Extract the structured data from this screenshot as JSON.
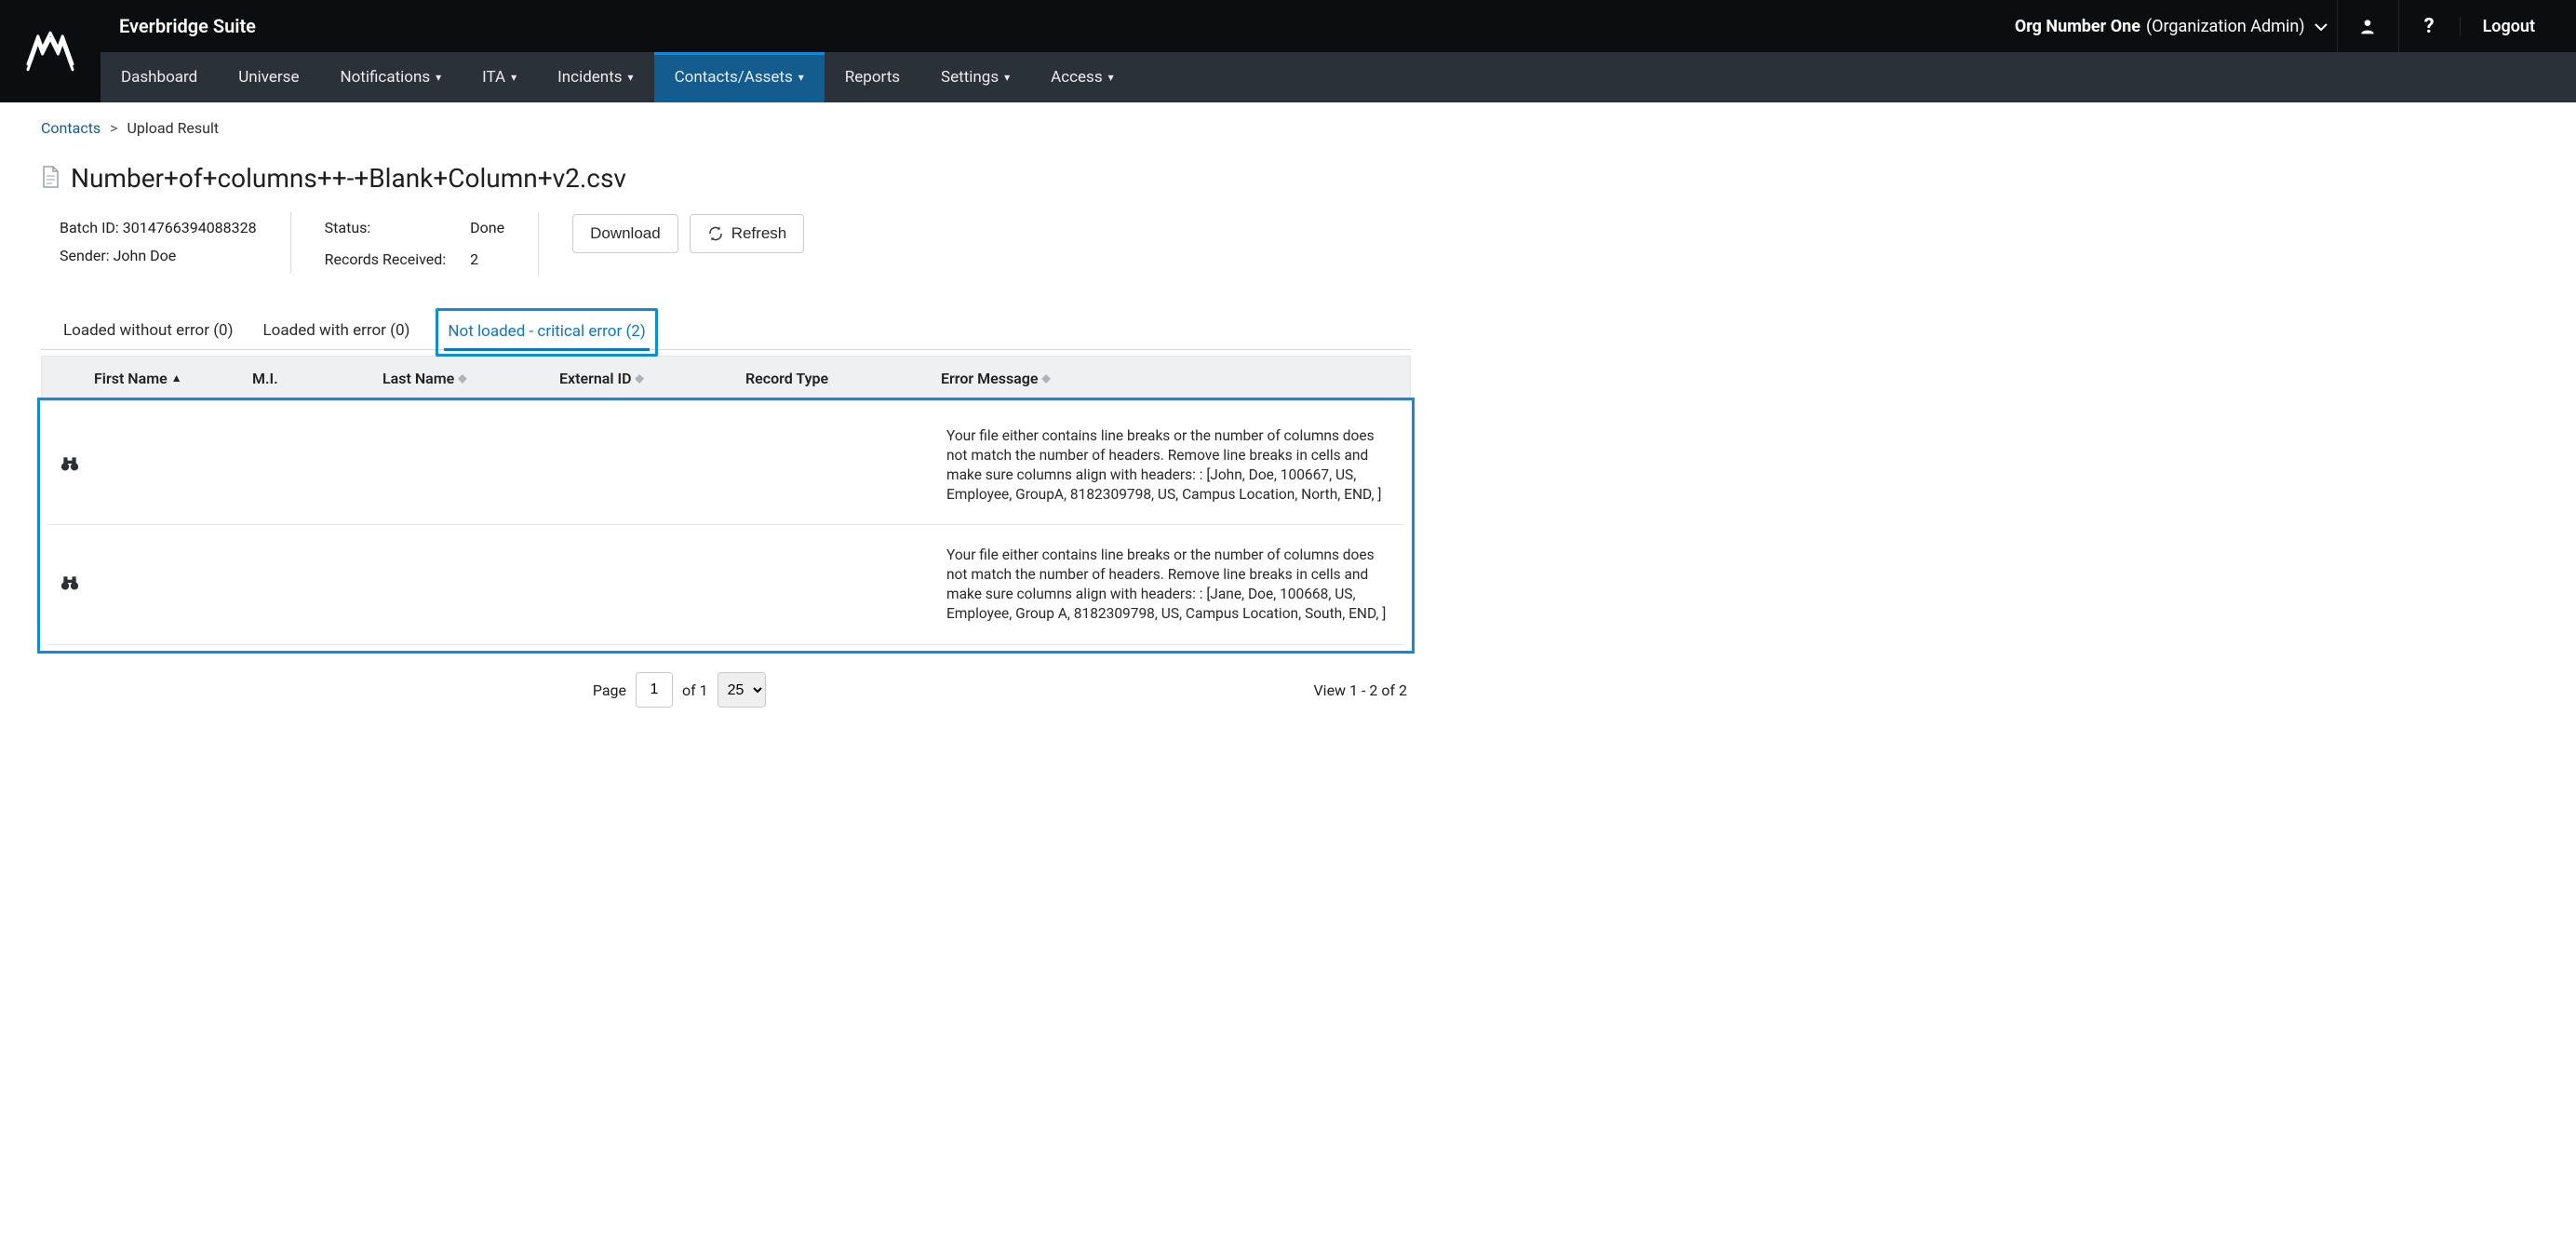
{
  "brand": {
    "suite_title": "Everbridge Suite"
  },
  "header": {
    "org_name": "Org Number One",
    "org_role": "(Organization Admin)",
    "logout": "Logout"
  },
  "nav": {
    "items": [
      {
        "label": "Dashboard",
        "dropdown": false
      },
      {
        "label": "Universe",
        "dropdown": false
      },
      {
        "label": "Notifications",
        "dropdown": true
      },
      {
        "label": "ITA",
        "dropdown": true
      },
      {
        "label": "Incidents",
        "dropdown": true
      },
      {
        "label": "Contacts/Assets",
        "dropdown": true,
        "active": true
      },
      {
        "label": "Reports",
        "dropdown": false
      },
      {
        "label": "Settings",
        "dropdown": true
      },
      {
        "label": "Access",
        "dropdown": true
      }
    ]
  },
  "breadcrumb": {
    "link": "Contacts",
    "current": "Upload Result"
  },
  "file": {
    "name": "Number+of+columns++-+Blank+Column+v2.csv"
  },
  "meta": {
    "batch_id_label": "Batch ID:",
    "batch_id": "3014766394088328",
    "sender_label": "Sender:",
    "sender": "John Doe",
    "status_label": "Status:",
    "status": "Done",
    "records_label": "Records Received:",
    "records": "2"
  },
  "buttons": {
    "download": "Download",
    "refresh": "Refresh"
  },
  "tabs": [
    {
      "label": "Loaded without error (0)"
    },
    {
      "label": "Loaded with error (0)"
    },
    {
      "label": "Not loaded - critical error (2)",
      "active": true
    }
  ],
  "table": {
    "columns": {
      "first_name": "First Name",
      "mi": "M.I.",
      "last_name": "Last Name",
      "external_id": "External ID",
      "record_type": "Record Type",
      "error_message": "Error Message"
    },
    "rows": [
      {
        "error": "Your file either contains line breaks or the number of columns does not match the number of headers. Remove line breaks in cells and make sure columns align with headers: : [John, Doe, 100667, US, Employee, GroupA, 8182309798, US, Campus Location, North, END, ]"
      },
      {
        "error": "Your file either contains line breaks or the number of columns does not match the number of headers. Remove line breaks in cells and make sure columns align with headers: : [Jane, Doe, 100668, US, Employee, Group A, 8182309798, US, Campus Location, South, END, ]"
      }
    ]
  },
  "pager": {
    "page_label": "Page",
    "page_value": "1",
    "of_label": "of 1",
    "page_size": "25",
    "view_text": "View 1 - 2 of 2"
  }
}
